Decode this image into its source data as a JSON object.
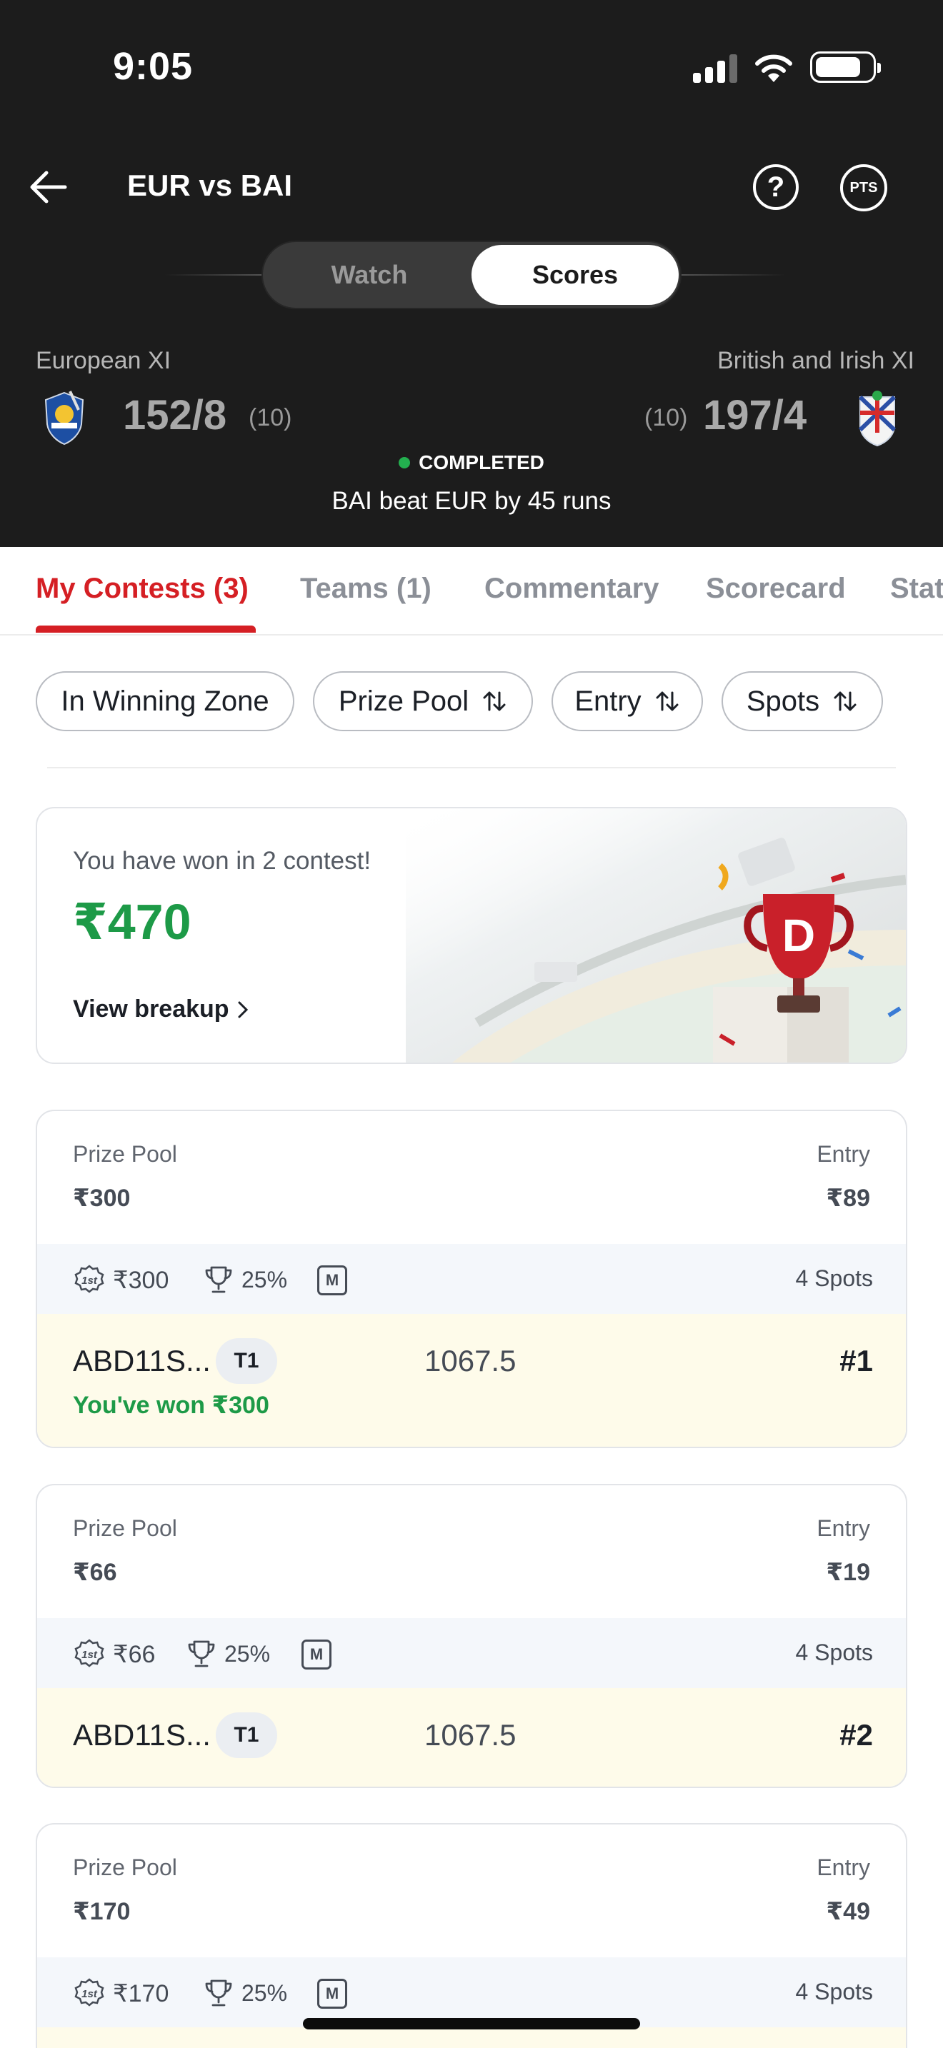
{
  "status_bar": {
    "time": "9:05"
  },
  "header": {
    "title": "EUR vs BAI",
    "help_label": "?",
    "pts_label": "PTS",
    "toggle": {
      "watch_label": "Watch",
      "scores_label": "Scores",
      "selected": "Scores"
    }
  },
  "match": {
    "team_left": {
      "name": "European XI",
      "score": "152/8",
      "overs": "(10)"
    },
    "team_right": {
      "name": "British and Irish XI",
      "score": "197/4",
      "overs": "(10)"
    },
    "status": "COMPLETED",
    "result": "BAI beat EUR by 45 runs"
  },
  "tabs": [
    "My Contests (3)",
    "Teams (1)",
    "Commentary",
    "Scorecard",
    "Stats"
  ],
  "filters": {
    "winning_zone": "In Winning Zone",
    "prize_pool": "Prize Pool",
    "entry": "Entry",
    "spots": "Spots"
  },
  "won_banner": {
    "text": "You have won in 2 contest!",
    "amount": "₹470",
    "breakup_label": "View breakup"
  },
  "contests": [
    {
      "prize_pool_label": "Prize Pool",
      "prize_pool": "₹300",
      "entry_label": "Entry",
      "entry": "₹89",
      "first_prize": "₹300",
      "winners_pct": "25%",
      "m_badge": "M",
      "spots": "4 Spots",
      "team": "ABD11S...",
      "team_badge": "T1",
      "points": "1067.5",
      "rank": "#1",
      "won_text": "You've won ₹300"
    },
    {
      "prize_pool_label": "Prize Pool",
      "prize_pool": "₹66",
      "entry_label": "Entry",
      "entry": "₹19",
      "first_prize": "₹66",
      "winners_pct": "25%",
      "m_badge": "M",
      "spots": "4 Spots",
      "team": "ABD11S...",
      "team_badge": "T1",
      "points": "1067.5",
      "rank": "#2"
    },
    {
      "prize_pool_label": "Prize Pool",
      "prize_pool": "₹170",
      "entry_label": "Entry",
      "entry": "₹49",
      "first_prize": "₹170",
      "winners_pct": "25%",
      "m_badge": "M",
      "spots": "4 Spots"
    }
  ],
  "colors": {
    "header_bg": "#1c1c1c",
    "accent_red": "#d51f24",
    "win_green": "#1d9a47",
    "live_green": "#23b04f"
  }
}
